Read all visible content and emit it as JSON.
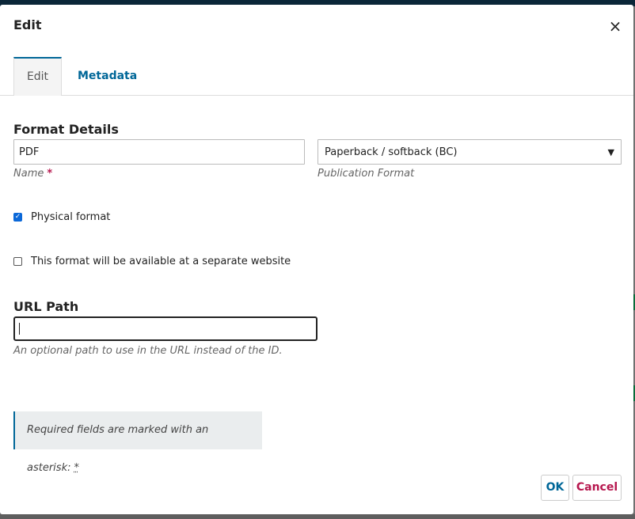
{
  "dialog": {
    "title": "Edit",
    "close_icon": "close-icon"
  },
  "tabs": [
    {
      "label": "Edit",
      "active": true
    },
    {
      "label": "Metadata",
      "active": false
    }
  ],
  "format_details": {
    "heading": "Format Details",
    "name": {
      "value": "PDF",
      "label": "Name",
      "required_marker": "*"
    },
    "publication_format": {
      "selected": "Paperback / softback (BC)",
      "label": "Publication Format"
    }
  },
  "checkboxes": {
    "physical": {
      "label": "Physical format",
      "checked": true
    },
    "separate_website": {
      "label": "This format will be available at a separate website",
      "checked": false
    }
  },
  "url_path": {
    "heading": "URL Path",
    "value": "",
    "help": "An optional path to use in the URL instead of the ID."
  },
  "notice": {
    "text": "Required fields are marked with an asterisk:",
    "asterisk": "*"
  },
  "buttons": {
    "ok": "OK",
    "cancel": "Cancel"
  },
  "colors": {
    "primary": "#006798",
    "danger": "#b7184f",
    "checkbox": "#0b68d8"
  }
}
